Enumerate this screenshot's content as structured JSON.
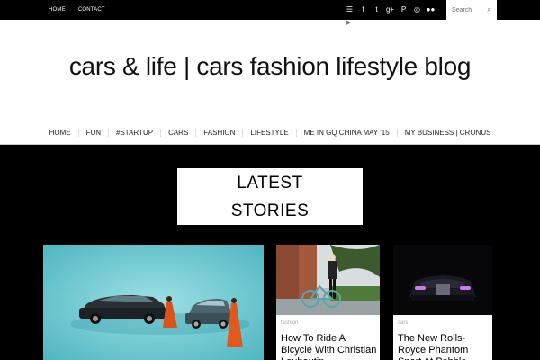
{
  "topnav": {
    "home": "HOME",
    "contact": "CONTACT"
  },
  "social": {
    "rss": "☰",
    "facebook": "f",
    "twitter": "t",
    "gplus": "g+",
    "pinterest": "P",
    "instagram": "◎",
    "flickr": "●●",
    "youtube": "▶"
  },
  "search": {
    "placeholder": "Search",
    "icon": "⌕"
  },
  "site_title": "cars & life | cars fashion lifestyle blog",
  "nav": [
    "HOME",
    "FUN",
    "#STARTUP",
    "CARS",
    "FASHION",
    "LIFESTYLE",
    "ME IN GQ CHINA MAY '15",
    "MY BUSINESS | CRONUS"
  ],
  "latest": {
    "line1": "LATEST",
    "line2": "STORIES"
  },
  "cards": [
    {
      "category": "",
      "title": ""
    },
    {
      "category": "fashion",
      "title": "How To Ride A Bicycle With Christian Louboutin"
    },
    {
      "category": "cars",
      "title": "The New Rolls-Royce Phantom Sport At Pebble"
    }
  ],
  "colors": {
    "topbar": "#000000",
    "page_bg": "#000000",
    "header_bg": "#ffffff",
    "card_image_blue": "#69c6ce"
  }
}
